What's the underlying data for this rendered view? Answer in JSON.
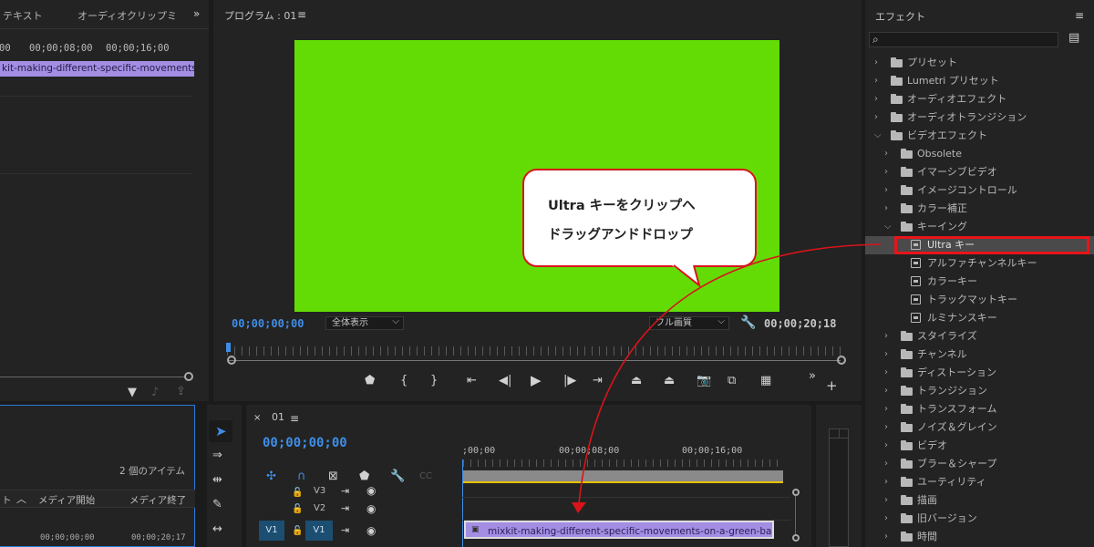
{
  "left_panel": {
    "tabs": [
      "テキスト",
      "オーディオクリップミ"
    ],
    "overflow_icon": "double-chevron-right-icon",
    "ruler_times": [
      "00",
      "00;00;08;00",
      "00;00;16;00"
    ],
    "clip_name": "kit-making-different-specific-movements-on"
  },
  "project_panel": {
    "item_count": "2 個のアイテム",
    "columns": [
      "ト",
      "メディア開始",
      "メディア終了"
    ],
    "row": [
      "00;00;00;00",
      "00;00;20;17"
    ]
  },
  "program_monitor": {
    "title": "プログラム : 01",
    "menu_icon": "hamburger-icon",
    "current_time": "00;00;00;00",
    "zoom": "全体表示",
    "quality": "フル画質",
    "duration": "00;00;20;18",
    "video_color": "#63dc06"
  },
  "timeline": {
    "sequence_name": "01",
    "timecode": "00;00;00;00",
    "ruler_times": [
      ";00;00",
      "00;00;08;00",
      "00;00;16;00"
    ],
    "tracks": [
      "V3",
      "V2",
      "V1"
    ],
    "source_patch": "V1",
    "clip_name": "mixkit-making-different-specific-movements-on-a-green-back"
  },
  "effects_panel": {
    "title": "エフェクト",
    "search_placeholder": "",
    "items": [
      {
        "label": "プリセット",
        "level": 0,
        "icon": "preset-folder-icon"
      },
      {
        "label": "Lumetri プリセット",
        "level": 0,
        "icon": "preset-folder-icon"
      },
      {
        "label": "オーディオエフェクト",
        "level": 0,
        "icon": "folder-icon"
      },
      {
        "label": "オーディオトランジション",
        "level": 0,
        "icon": "folder-icon"
      },
      {
        "label": "ビデオエフェクト",
        "level": 0,
        "icon": "folder-icon",
        "expanded": true
      },
      {
        "label": "Obsolete",
        "level": 1,
        "icon": "folder-icon"
      },
      {
        "label": "イマーシブビデオ",
        "level": 1,
        "icon": "folder-icon"
      },
      {
        "label": "イメージコントロール",
        "level": 1,
        "icon": "folder-icon"
      },
      {
        "label": "カラー補正",
        "level": 1,
        "icon": "folder-icon"
      },
      {
        "label": "キーイング",
        "level": 1,
        "icon": "folder-icon",
        "expanded": true
      },
      {
        "label": "Ultra キー",
        "level": 2,
        "icon": "effect-icon",
        "selected": true
      },
      {
        "label": "アルファチャンネルキー",
        "level": 2,
        "icon": "effect-icon"
      },
      {
        "label": "カラーキー",
        "level": 2,
        "icon": "effect-icon"
      },
      {
        "label": "トラックマットキー",
        "level": 2,
        "icon": "effect-icon"
      },
      {
        "label": "ルミナンスキー",
        "level": 2,
        "icon": "effect-icon"
      },
      {
        "label": "スタイライズ",
        "level": 1,
        "icon": "folder-icon"
      },
      {
        "label": "チャンネル",
        "level": 1,
        "icon": "folder-icon"
      },
      {
        "label": "ディストーション",
        "level": 1,
        "icon": "folder-icon"
      },
      {
        "label": "トランジション",
        "level": 1,
        "icon": "folder-icon"
      },
      {
        "label": "トランスフォーム",
        "level": 1,
        "icon": "folder-icon"
      },
      {
        "label": "ノイズ＆グレイン",
        "level": 1,
        "icon": "folder-icon"
      },
      {
        "label": "ビデオ",
        "level": 1,
        "icon": "folder-icon"
      },
      {
        "label": "ブラー＆シャープ",
        "level": 1,
        "icon": "folder-icon"
      },
      {
        "label": "ユーティリティ",
        "level": 1,
        "icon": "folder-icon"
      },
      {
        "label": "描画",
        "level": 1,
        "icon": "folder-icon"
      },
      {
        "label": "旧バージョン",
        "level": 1,
        "icon": "folder-icon"
      },
      {
        "label": "時間",
        "level": 1,
        "icon": "folder-icon"
      }
    ]
  },
  "annotation": {
    "line1": "Ultra キーをクリップへ",
    "line2": "ドラッグアンドドロップ",
    "color": "#d8141a"
  }
}
